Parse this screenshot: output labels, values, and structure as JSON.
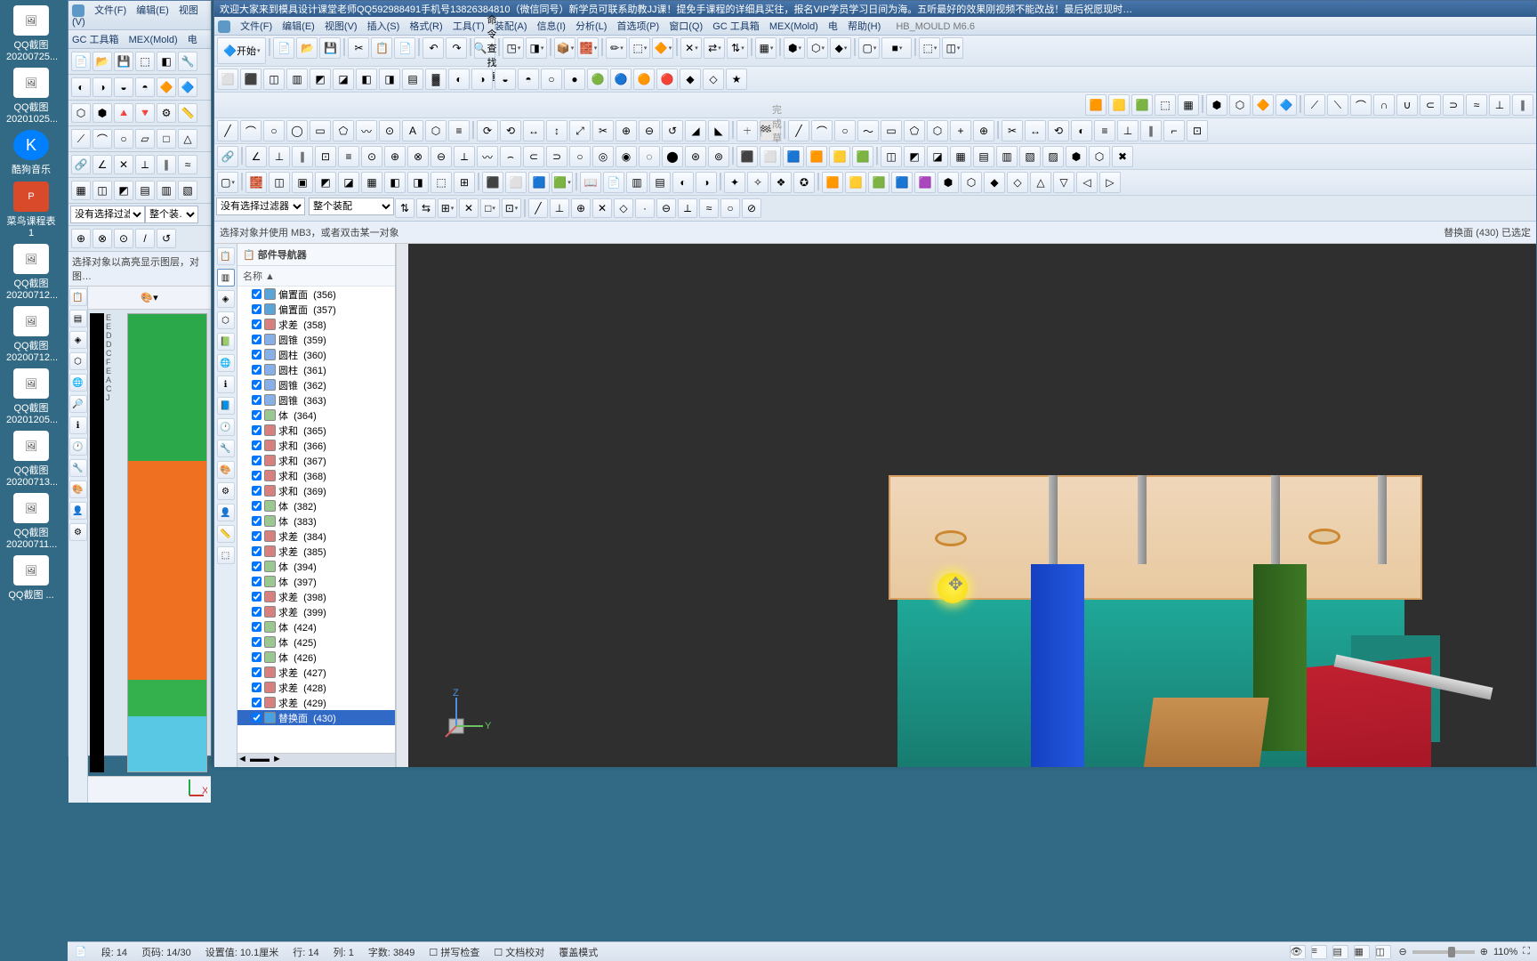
{
  "desktop": {
    "icons": [
      {
        "label": "QQ截图\n20200725...",
        "kind": "img"
      },
      {
        "label": "QQ截图\n20201025...",
        "kind": "img"
      },
      {
        "label": "酷狗音乐",
        "kind": "kugou"
      },
      {
        "label": "菜鸟课程表1",
        "kind": "pdf"
      },
      {
        "label": "QQ截图\n20200712...",
        "kind": "img"
      },
      {
        "label": "QQ截图\n20200712...",
        "kind": "img"
      },
      {
        "label": "QQ截图\n20201205...",
        "kind": "img"
      },
      {
        "label": "QQ截图\n20200713...",
        "kind": "img"
      },
      {
        "label": "QQ截图\n20200711...",
        "kind": "img"
      },
      {
        "label": "QQ截图\n...",
        "kind": "img"
      }
    ]
  },
  "win1": {
    "menu": [
      "文件(F)",
      "编辑(E)",
      "视图(V)"
    ],
    "menu2": [
      "GC 工具箱",
      "MEX(Mold)",
      "电",
      "…"
    ],
    "filter1": "没有选择过滤器",
    "filter2": "整个装…",
    "hint": "选择对象以高亮显示图层，对图…"
  },
  "win2": {
    "title": "欢迎大家来到模具设计课堂老师QQ592988491手机号13826384810（微信同号）新学员可联系助教JJ课！提免手课程的详细具买往，报名VIP学员学习日间为海。五听最好的效果刚视频不能改战！最后祝愿现时…",
    "menu": [
      "文件(F)",
      "编辑(E)",
      "视图(V)",
      "插入(S)",
      "格式(R)",
      "工具(T)",
      "装配(A)",
      "信息(I)",
      "分析(L)",
      "首选项(P)",
      "窗口(Q)",
      "GC 工具箱",
      "MEX(Mold)",
      "电",
      "帮助(H)",
      "HB_MOULD M6.6"
    ],
    "start": "开始",
    "cmdFinder": "命令查找器",
    "finish": "完成草图",
    "filter1": "没有选择过滤器",
    "filter2": "整个装配",
    "prompt": "选择对象并使用 MB3，或者双击某一对象",
    "selection": "替换面 (430)  已选定",
    "nav": {
      "title": "部件导航器",
      "col": "名称 ▲",
      "items": [
        {
          "n": "偏置面",
          "i": "356",
          "c": "#5aa4d8"
        },
        {
          "n": "偏置面",
          "i": "357",
          "c": "#5aa4d8"
        },
        {
          "n": "求差",
          "i": "358",
          "c": "#d88080"
        },
        {
          "n": "圆锥",
          "i": "359",
          "c": "#88b0e8"
        },
        {
          "n": "圆柱",
          "i": "360",
          "c": "#88b0e8"
        },
        {
          "n": "圆柱",
          "i": "361",
          "c": "#88b0e8"
        },
        {
          "n": "圆锥",
          "i": "362",
          "c": "#88b0e8"
        },
        {
          "n": "圆锥",
          "i": "363",
          "c": "#88b0e8"
        },
        {
          "n": "体",
          "i": "364",
          "c": "#9ac890"
        },
        {
          "n": "求和",
          "i": "365",
          "c": "#d88080"
        },
        {
          "n": "求和",
          "i": "366",
          "c": "#d88080"
        },
        {
          "n": "求和",
          "i": "367",
          "c": "#d88080"
        },
        {
          "n": "求和",
          "i": "368",
          "c": "#d88080"
        },
        {
          "n": "求和",
          "i": "369",
          "c": "#d88080"
        },
        {
          "n": "体",
          "i": "382",
          "c": "#9ac890"
        },
        {
          "n": "体",
          "i": "383",
          "c": "#9ac890"
        },
        {
          "n": "求差",
          "i": "384",
          "c": "#d88080"
        },
        {
          "n": "求差",
          "i": "385",
          "c": "#d88080"
        },
        {
          "n": "体",
          "i": "394",
          "c": "#9ac890"
        },
        {
          "n": "体",
          "i": "397",
          "c": "#9ac890"
        },
        {
          "n": "求差",
          "i": "398",
          "c": "#d88080"
        },
        {
          "n": "求差",
          "i": "399",
          "c": "#d88080"
        },
        {
          "n": "体",
          "i": "424",
          "c": "#9ac890"
        },
        {
          "n": "体",
          "i": "425",
          "c": "#9ac890"
        },
        {
          "n": "体",
          "i": "426",
          "c": "#9ac890"
        },
        {
          "n": "求差",
          "i": "427",
          "c": "#d88080"
        },
        {
          "n": "求差",
          "i": "428",
          "c": "#d88080"
        },
        {
          "n": "求差",
          "i": "429",
          "c": "#d88080"
        },
        {
          "n": "替换面",
          "i": "430",
          "c": "#4aa0e0",
          "sel": true
        }
      ]
    }
  },
  "status": {
    "segs": [
      "段: 14",
      "页码: 14/30",
      "设置值: 10.1厘米",
      "行: 14",
      "列: 1",
      "字数: 3849"
    ],
    "checks": [
      "拼写检查",
      "文档校对",
      "覆盖模式"
    ],
    "zoom": "110%"
  }
}
